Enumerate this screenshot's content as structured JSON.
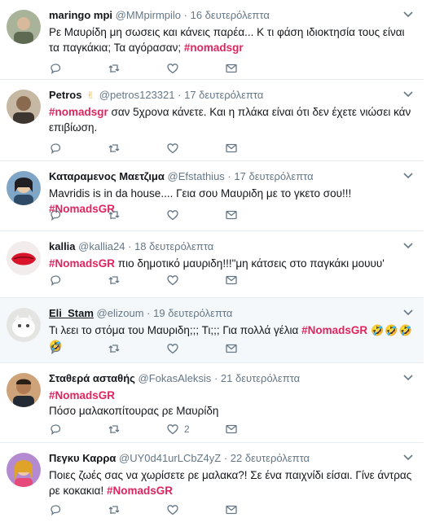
{
  "tweets": [
    {
      "name": "maringo mpi",
      "handle": "@MMpirmpilo",
      "sep": "·",
      "time": "16 δευτερόλεπτα",
      "text_before": "Ρε Μαυρίδη μη σωσεις και κάνεις παρέα... Κ τι φάση ιδιοκτησία τους είναι τα παγκάκια; Τα αγόρασαν; ",
      "hashtag": "#nomadsgr",
      "text_after": "",
      "likes": ""
    },
    {
      "name": "Petros",
      "badge": "✌",
      "handle": "@petros123321",
      "sep": "·",
      "time": "17 δευτερόλεπτα",
      "text_before": "",
      "hashtag": "#nomadsgr",
      "text_after": " σαν 5χρονα κάνετε. Και η πλάκα είναι ότι δεν έχετε νιώσει κάν επιβίωση.",
      "likes": ""
    },
    {
      "name": "Καταραμενος Μαετζιμα",
      "handle": "@Efstathius",
      "sep": "·",
      "time": "17 δευτερόλεπτα",
      "text_before": "Mavridis is in da house.... Γεια σου Μαυριδη με το γκετο σου!!! ",
      "hashtag": "#NomadsGR",
      "text_after": "",
      "likes": ""
    },
    {
      "name": "kallia",
      "handle": "@kallia24",
      "sep": "·",
      "time": "18 δευτερόλεπτα",
      "text_before": "",
      "hashtag": "#NomadsGR",
      "text_after": " πιο δημοτικό μαυριδη!!!\"μη κάτσεις στο παγκάκι μουυυ'",
      "likes": ""
    },
    {
      "name": "Eli_Stam",
      "handle": "@elizoum",
      "sep": "·",
      "time": "19 δευτερόλεπτα",
      "text_before": "Τι λεει το στόμα του Μαυριδη;;; Τι;;; Για πολλά γέλια ",
      "hashtag": "#NomadsGR",
      "text_after": "",
      "emoji": "🤣🤣🤣🤣",
      "likes": ""
    },
    {
      "name": "Σταθερά ασταθής",
      "handle": "@FokasAleksis",
      "sep": "·",
      "time": "21 δευτερόλεπτα",
      "text_before": "",
      "hashtag": "#NomadsGR",
      "text_after": "",
      "line2": "Πόσο μαλακοπίτουρας ρε Μαυρίδη",
      "likes": "2"
    },
    {
      "name": "Πεγκυ Καρρα",
      "handle": "@UY0d41urLCbZ4yZ",
      "sep": "·",
      "time": "22 δευτερόλεπτα",
      "text_before": "Ποιες ζωές σας να χωρίσετε ρε μαλακα?! Σε ένα παιχνίδι είσαι. Γίνε άντρας ρε κοκακια! ",
      "hashtag": "#NomadsGR",
      "text_after": "",
      "likes": ""
    }
  ],
  "colors": {
    "hashtag": "#e0245e",
    "muted": "#657786",
    "text": "#14171a",
    "highlight_bg": "#f5f8fa"
  },
  "icons": [
    "reply-icon",
    "retweet-icon",
    "like-icon",
    "message-icon",
    "chevron-down-icon"
  ]
}
